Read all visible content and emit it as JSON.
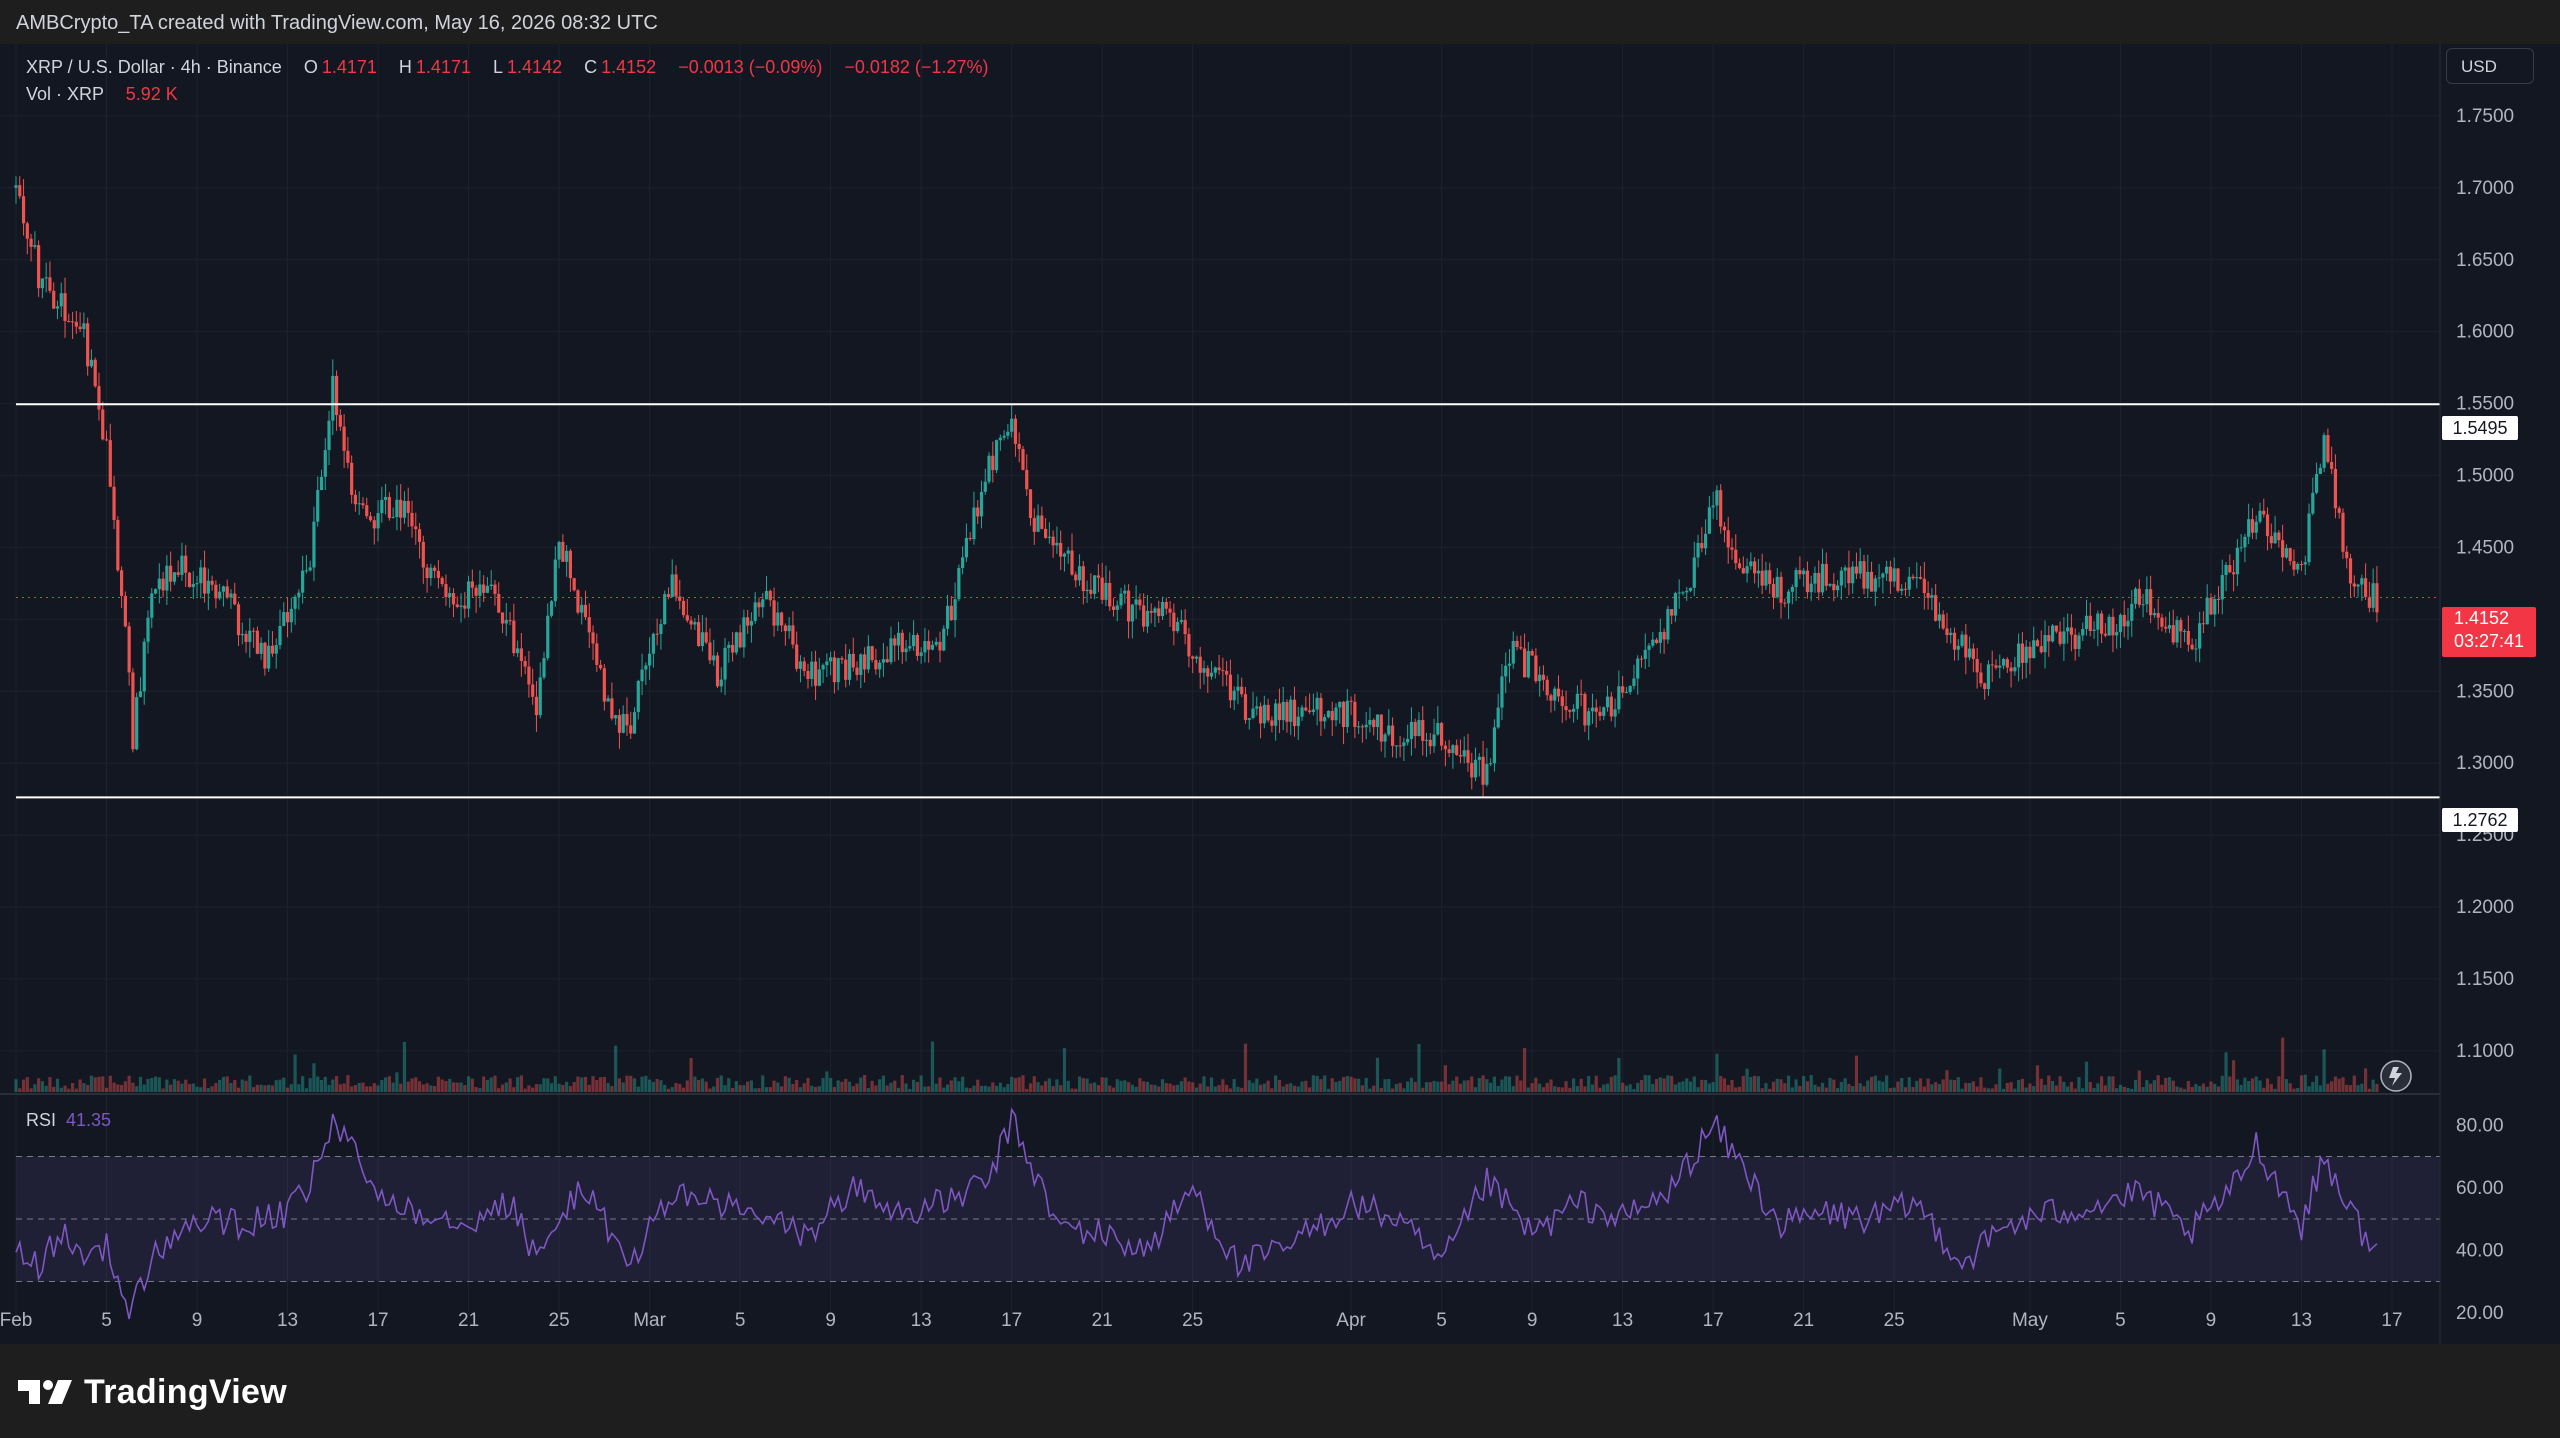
{
  "header": {
    "attribution": "AMBCrypto_TA created with TradingView.com, May 16, 2026 08:32 UTC"
  },
  "legend": {
    "symbol": "XRP / U.S. Dollar · 4h · Binance",
    "open_label": "O",
    "open": "1.4171",
    "high_label": "H",
    "high": "1.4171",
    "low_label": "L",
    "low": "1.4142",
    "close_label": "C",
    "close": "1.4152",
    "change": "−0.0013 (−0.09%)",
    "change2": "−0.0182 (−1.27%)",
    "volume_label": "Vol · XRP",
    "volume": "5.92 K"
  },
  "currency_button": "USD",
  "price_badge": {
    "price": "1.4152",
    "countdown": "03:27:41"
  },
  "levels": {
    "resistance": "1.5495",
    "support": "1.2762"
  },
  "rsi": {
    "label": "RSI",
    "value": "41.35"
  },
  "footer": {
    "brand": "TradingView"
  },
  "colors": {
    "up": "#26a69a",
    "down": "#ef5350",
    "rsi": "#7e57c2",
    "background": "#131722",
    "price_badge": "#f23645"
  },
  "chart_data": [
    {
      "type": "candlestick",
      "title": "XRP / U.S. Dollar · 4h · Binance",
      "x_ticks": [
        "Feb",
        "5",
        "9",
        "13",
        "17",
        "21",
        "25",
        "Mar",
        "5",
        "9",
        "13",
        "17",
        "21",
        "25",
        "Apr",
        "5",
        "9",
        "13",
        "17",
        "21",
        "25",
        "May",
        "5",
        "9",
        "13",
        "17"
      ],
      "x_tick_dates": [
        "2026-02-01",
        "2026-02-05",
        "2026-02-09",
        "2026-02-13",
        "2026-02-17",
        "2026-02-21",
        "2026-02-25",
        "2026-03-01",
        "2026-03-05",
        "2026-03-09",
        "2026-03-13",
        "2026-03-17",
        "2026-03-21",
        "2026-03-25",
        "2026-04-01",
        "2026-04-05",
        "2026-04-09",
        "2026-04-13",
        "2026-04-17",
        "2026-04-21",
        "2026-04-25",
        "2026-05-01",
        "2026-05-05",
        "2026-05-09",
        "2026-05-13",
        "2026-05-17"
      ],
      "y_ticks": [
        "1.7500",
        "1.7000",
        "1.6500",
        "1.6000",
        "1.5500",
        "1.5000",
        "1.4500",
        "1.4000",
        "1.3500",
        "1.3000",
        "1.2500",
        "1.2000",
        "1.1500",
        "1.1000"
      ],
      "y_range": [
        1.07,
        1.8
      ],
      "horizontal_lines": [
        1.5495,
        1.2762
      ],
      "price_path": {
        "dates": [
          "2026-02-01",
          "2026-02-02",
          "2026-02-03",
          "2026-02-04",
          "2026-02-05",
          "2026-02-06",
          "2026-02-06",
          "2026-02-07",
          "2026-02-08",
          "2026-02-10",
          "2026-02-12",
          "2026-02-14",
          "2026-02-15",
          "2026-02-16",
          "2026-02-18",
          "2026-02-20",
          "2026-02-22",
          "2026-02-24",
          "2026-02-25",
          "2026-02-27",
          "2026-02-28",
          "2026-03-02",
          "2026-03-04",
          "2026-03-06",
          "2026-03-08",
          "2026-03-10",
          "2026-03-12",
          "2026-03-14",
          "2026-03-16",
          "2026-03-17",
          "2026-03-18",
          "2026-03-20",
          "2026-03-22",
          "2026-03-24",
          "2026-03-26",
          "2026-03-28",
          "2026-03-31",
          "2026-04-03",
          "2026-04-05",
          "2026-04-07",
          "2026-04-08",
          "2026-04-10",
          "2026-04-12",
          "2026-04-14",
          "2026-04-16",
          "2026-04-17",
          "2026-04-18",
          "2026-04-20",
          "2026-04-22",
          "2026-04-24",
          "2026-04-26",
          "2026-04-28",
          "2026-04-29",
          "2026-05-01",
          "2026-05-03",
          "2026-05-05",
          "2026-05-06",
          "2026-05-08",
          "2026-05-10",
          "2026-05-11",
          "2026-05-13",
          "2026-05-14",
          "2026-05-15",
          "2026-05-16"
        ],
        "values": [
          1.7,
          1.64,
          1.62,
          1.6,
          1.52,
          1.36,
          1.3,
          1.42,
          1.44,
          1.42,
          1.37,
          1.44,
          1.56,
          1.47,
          1.48,
          1.41,
          1.43,
          1.34,
          1.46,
          1.35,
          1.32,
          1.43,
          1.36,
          1.42,
          1.36,
          1.37,
          1.38,
          1.39,
          1.51,
          1.53,
          1.47,
          1.43,
          1.41,
          1.4,
          1.36,
          1.33,
          1.34,
          1.32,
          1.32,
          1.29,
          1.38,
          1.35,
          1.33,
          1.37,
          1.43,
          1.49,
          1.44,
          1.42,
          1.43,
          1.43,
          1.43,
          1.38,
          1.36,
          1.38,
          1.39,
          1.4,
          1.42,
          1.38,
          1.44,
          1.47,
          1.43,
          1.53,
          1.44,
          1.4152
        ]
      },
      "volume_last": "5.92 K"
    },
    {
      "type": "line",
      "title": "RSI",
      "y_ticks": [
        "80.00",
        "60.00",
        "40.00",
        "20.00"
      ],
      "y_range": [
        10,
        90
      ],
      "band": [
        30,
        70
      ],
      "midline": 50,
      "series": [
        {
          "name": "RSI",
          "dates": [
            "2026-02-01",
            "2026-02-02",
            "2026-02-03",
            "2026-02-04",
            "2026-02-05",
            "2026-02-06",
            "2026-02-07",
            "2026-02-09",
            "2026-02-11",
            "2026-02-13",
            "2026-02-14",
            "2026-02-15",
            "2026-02-17",
            "2026-02-19",
            "2026-02-21",
            "2026-02-23",
            "2026-02-24",
            "2026-02-26",
            "2026-02-28",
            "2026-03-02",
            "2026-03-04",
            "2026-03-06",
            "2026-03-08",
            "2026-03-10",
            "2026-03-12",
            "2026-03-14",
            "2026-03-16",
            "2026-03-17",
            "2026-03-19",
            "2026-03-21",
            "2026-03-23",
            "2026-03-25",
            "2026-03-27",
            "2026-03-29",
            "2026-04-01",
            "2026-04-03",
            "2026-04-05",
            "2026-04-07",
            "2026-04-09",
            "2026-04-11",
            "2026-04-13",
            "2026-04-15",
            "2026-04-17",
            "2026-04-18",
            "2026-04-20",
            "2026-04-22",
            "2026-04-24",
            "2026-04-26",
            "2026-04-28",
            "2026-04-30",
            "2026-05-02",
            "2026-05-04",
            "2026-05-06",
            "2026-05-08",
            "2026-05-10",
            "2026-05-11",
            "2026-05-13",
            "2026-05-14",
            "2026-05-16"
          ],
          "values": [
            40,
            35,
            45,
            38,
            42,
            18,
            38,
            50,
            48,
            52,
            60,
            82,
            58,
            52,
            50,
            55,
            36,
            62,
            35,
            58,
            55,
            50,
            45,
            60,
            52,
            55,
            62,
            82,
            48,
            45,
            40,
            60,
            35,
            40,
            55,
            50,
            35,
            62,
            45,
            55,
            50,
            58,
            80,
            70,
            48,
            52,
            50,
            55,
            36,
            48,
            52,
            55,
            58,
            45,
            60,
            74,
            48,
            70,
            41.35
          ]
        }
      ]
    }
  ]
}
